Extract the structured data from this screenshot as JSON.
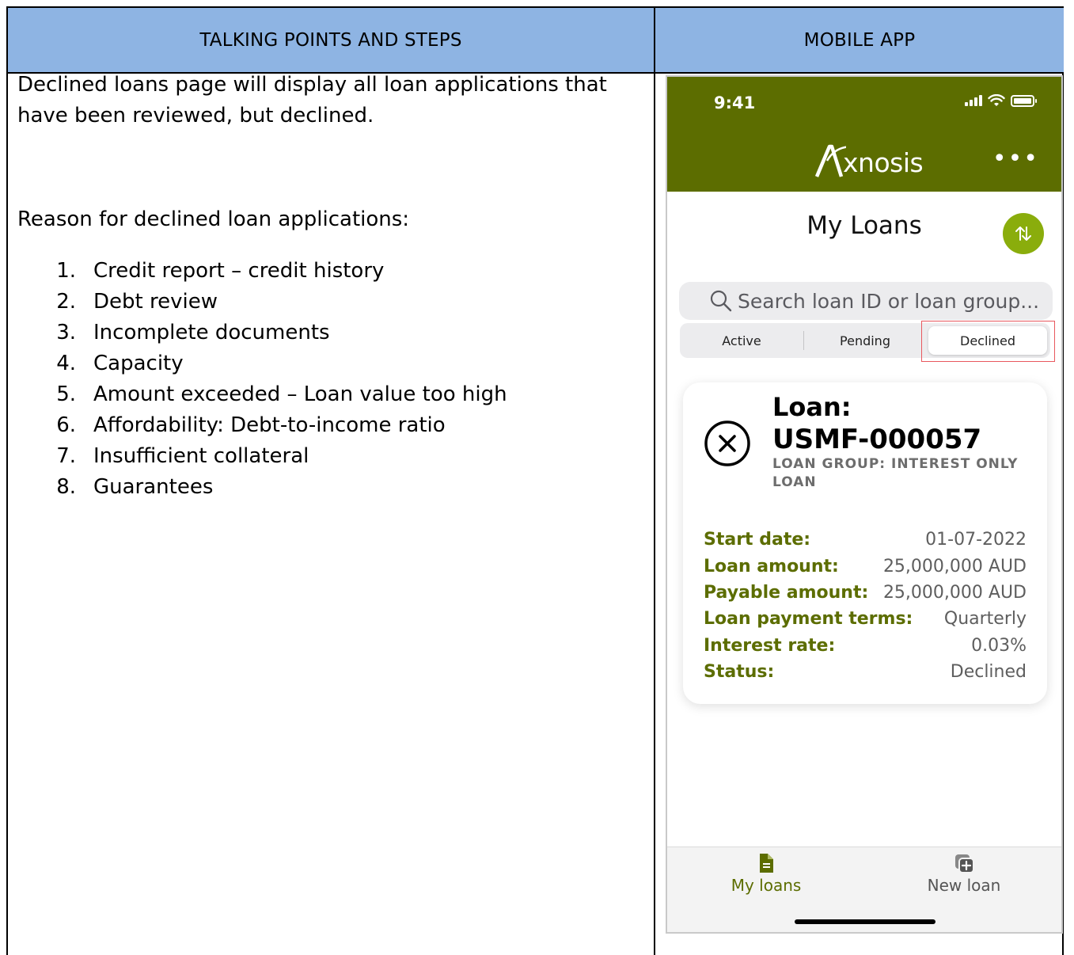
{
  "table": {
    "header_left": "TALKING POINTS AND STEPS",
    "header_right": "MOBILE APP"
  },
  "talking_points": {
    "intro": "Declined loans page will display all loan applications that have been reviewed, but declined.",
    "reason_heading": "Reason for declined loan applications:",
    "steps": [
      {
        "num": "1.",
        "text": "Credit report – credit history"
      },
      {
        "num": "2.",
        "text": "Debt review"
      },
      {
        "num": "3.",
        "text": "Incomplete documents"
      },
      {
        "num": "4.",
        "text": "Capacity"
      },
      {
        "num": "5.",
        "text": "Amount exceeded – Loan value too high"
      },
      {
        "num": "6.",
        "text": "Affordability: Debt-to-income ratio"
      },
      {
        "num": "7.",
        "text": "Insufficient collateral"
      },
      {
        "num": "8.",
        "text": "Guarantees"
      }
    ]
  },
  "phone": {
    "status_time": "9:41",
    "logo_text": "xnosis",
    "logo_full": "Axnosis",
    "more_label": "•••",
    "title": "My Loans",
    "search_placeholder": "Search loan ID or loan group...",
    "segments": [
      "Active",
      "Pending",
      "Declined"
    ],
    "selected_segment": "Declined",
    "card": {
      "loan_label": "Loan:",
      "loan_id": "USMF-000057",
      "loan_group": "LOAN GROUP: INTEREST ONLY LOAN",
      "status_icon": "x-circle-icon",
      "details": [
        {
          "key": "Start date:",
          "value": "01-07-2022"
        },
        {
          "key": "Loan amount:",
          "value": "25,000,000 AUD"
        },
        {
          "key": "Payable amount:",
          "value": "25,000,000 AUD"
        },
        {
          "key": "Loan payment terms:",
          "value": "Quarterly"
        },
        {
          "key": "Interest rate:",
          "value": "0.03%"
        },
        {
          "key": "Status:",
          "value": "Declined"
        }
      ]
    },
    "tabs": [
      {
        "label": "My loans",
        "icon": "document-icon",
        "active": true
      },
      {
        "label": "New loan",
        "icon": "add-copy-icon",
        "active": false
      }
    ]
  },
  "colors": {
    "header_blue": "#8eb4e3",
    "brand_olive": "#5c6d00",
    "accent_green": "#8aad0c",
    "highlight_red": "#e8585e"
  }
}
